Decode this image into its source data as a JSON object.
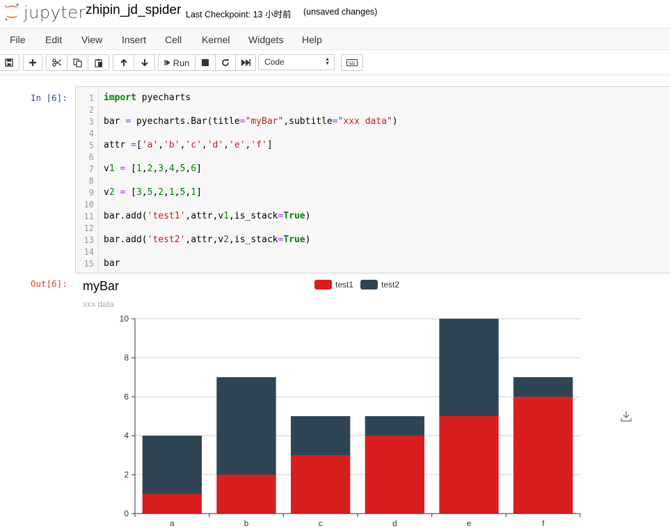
{
  "header": {
    "logo_text": "jupyter",
    "notebook_name": "zhipin_jd_spider",
    "checkpoint": "Last Checkpoint: 13 小时前",
    "unsaved": "(unsaved changes)"
  },
  "menu": {
    "items": [
      {
        "label": "File"
      },
      {
        "label": "Edit"
      },
      {
        "label": "View"
      },
      {
        "label": "Insert"
      },
      {
        "label": "Cell"
      },
      {
        "label": "Kernel"
      },
      {
        "label": "Widgets"
      },
      {
        "label": "Help"
      }
    ]
  },
  "toolbar": {
    "run_label": "Run",
    "cell_type": "Code",
    "icons": [
      "save-icon",
      "plus-icon",
      "cut-icon",
      "copy-icon",
      "paste-icon",
      "arrow-up-icon",
      "arrow-down-icon",
      "step-forward-icon",
      "stop-icon",
      "restart-icon",
      "fast-forward-icon",
      "keyboard-icon"
    ]
  },
  "cell": {
    "in_prompt": "In [6]:",
    "out_prompt": "Out[6]:",
    "line_numbers": [
      "1",
      "2",
      "3",
      "4",
      "5",
      "6",
      "7",
      "8",
      "9",
      "10",
      "11",
      "12",
      "13",
      "14",
      "15"
    ],
    "code_lines": [
      "import pyecharts",
      "",
      "bar = pyecharts.Bar(title=\"myBar\",subtitle=\"xxx data\")",
      "",
      "attr =['a','b','c','d','e','f']",
      "",
      "v1 = [1,2,3,4,5,6]",
      "",
      "v2 = [3,5,2,1,5,1]",
      "",
      "bar.add('test1',attr,v1,is_stack=True)",
      "",
      "bar.add('test2',attr,v2,is_stack=True)",
      "",
      "bar"
    ]
  },
  "chart_data": {
    "type": "bar",
    "stacked": true,
    "title": "myBar",
    "subtitle": "xxx data",
    "categories": [
      "a",
      "b",
      "c",
      "d",
      "e",
      "f"
    ],
    "series": [
      {
        "name": "test1",
        "values": [
          1,
          2,
          3,
          4,
          5,
          6
        ],
        "color": "#d81e1e"
      },
      {
        "name": "test2",
        "values": [
          3,
          5,
          2,
          1,
          5,
          1
        ],
        "color": "#2f4554"
      }
    ],
    "yticks": [
      "0",
      "2",
      "4",
      "6",
      "8",
      "10"
    ],
    "ylim": [
      0,
      10
    ],
    "grid": true,
    "legend_position": "top-center"
  },
  "colors": {
    "series1": "#d81e1e",
    "series2": "#2f4554",
    "in_prompt": "#303f9f",
    "out_prompt": "#d84315",
    "logo_orange": "#f37726"
  }
}
